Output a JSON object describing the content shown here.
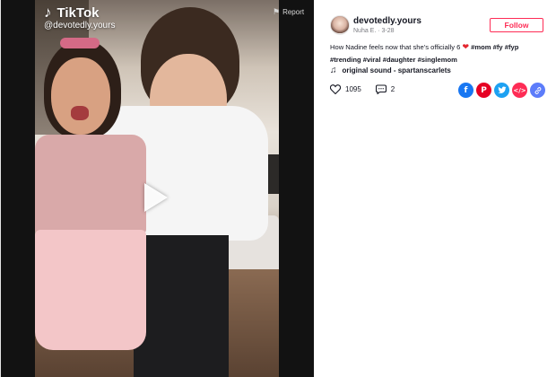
{
  "video": {
    "brand": "TikTok",
    "handle": "@devotedly.yours",
    "report_label": "Report"
  },
  "author": {
    "username": "devotedly.yours",
    "display_name": "Nuha E.",
    "date": "3-28",
    "follow_label": "Follow"
  },
  "caption": {
    "text": "How Nadine feels now that she’s officially 6",
    "hashtags_line1": [
      "#mom",
      "#fy",
      "#fyp"
    ],
    "hashtags_line2": [
      "#trending",
      "#viral",
      "#daughter",
      "#singlemom"
    ]
  },
  "music": {
    "label": "original sound - spartanscarlets"
  },
  "stats": {
    "likes": "1095",
    "comments": "2"
  },
  "share": [
    {
      "name": "facebook",
      "color": "#1877f2"
    },
    {
      "name": "pinterest",
      "color": "#e60023"
    },
    {
      "name": "twitter",
      "color": "#1da1f2"
    },
    {
      "name": "embed",
      "color": "#fe2c55"
    },
    {
      "name": "link",
      "color": "#5c7cfa"
    }
  ],
  "colors": {
    "accent": "#fe2c55",
    "text": "#161823",
    "muted": "#7a7b80"
  }
}
